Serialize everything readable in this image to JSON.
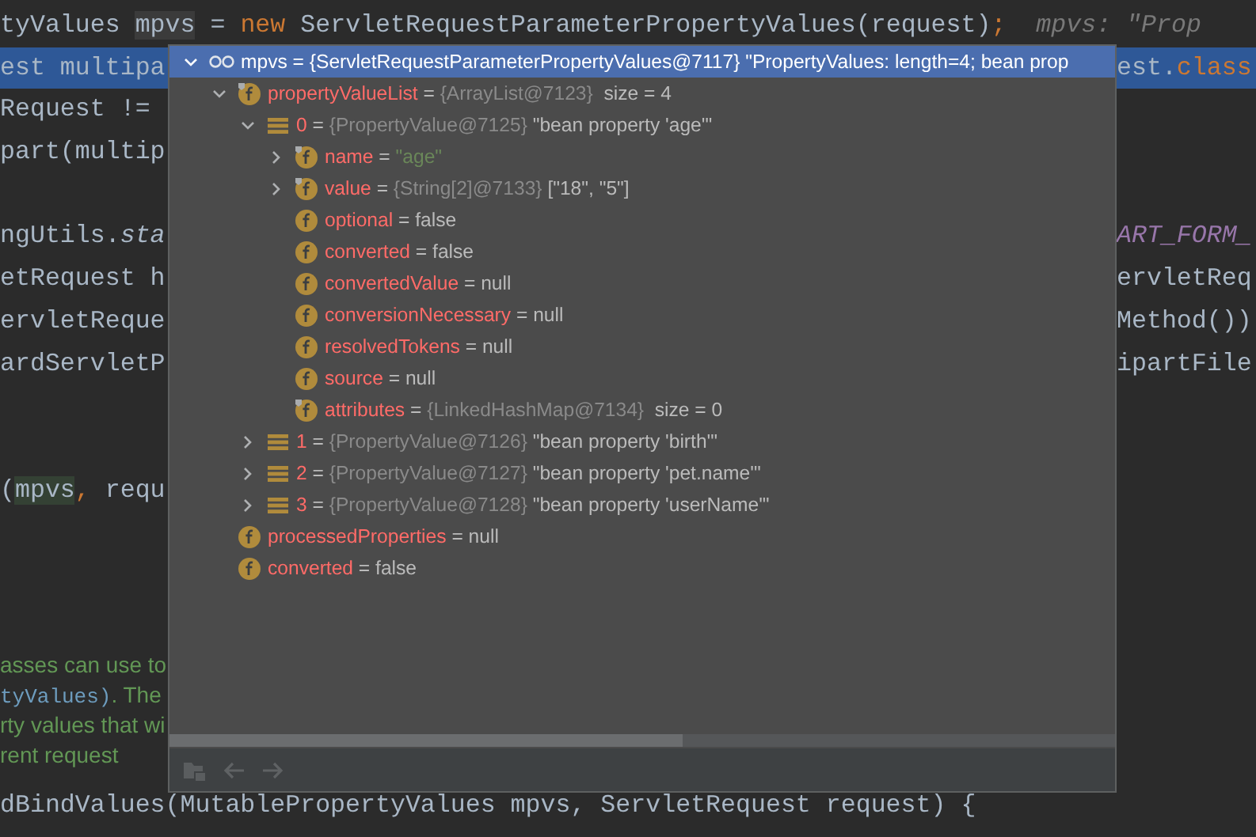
{
  "editor": {
    "lines": [
      {
        "kind": "code",
        "current": false,
        "left": [
          {
            "text": "tyValues ",
            "kind": "plain"
          },
          {
            "text": "mpvs",
            "kind": "usage"
          },
          {
            "text": " = ",
            "kind": "plain"
          },
          {
            "text": "new",
            "kind": "keyword"
          },
          {
            "text": " ServletRequestParameterPropertyValues(request)",
            "kind": "plain"
          },
          {
            "text": ";",
            "kind": "keyword"
          },
          {
            "text": "  mpvs: \"Prop",
            "kind": "hint"
          }
        ]
      },
      {
        "kind": "code",
        "current": true,
        "left": [
          {
            "text": "est multipa",
            "kind": "plain"
          }
        ],
        "right": [
          {
            "text": "est.",
            "kind": "plain"
          },
          {
            "text": "class",
            "kind": "keyword"
          }
        ]
      },
      {
        "kind": "code",
        "current": false,
        "left": [
          {
            "text": "Request !=",
            "kind": "plain"
          }
        ]
      },
      {
        "kind": "code",
        "current": false,
        "left": [
          {
            "text": "part(multip",
            "kind": "plain"
          }
        ]
      },
      {
        "kind": "blank",
        "current": false
      },
      {
        "kind": "code",
        "current": false,
        "left": [
          {
            "text": "ngUtils.",
            "kind": "plain"
          },
          {
            "text": "sta",
            "kind": "italic"
          }
        ],
        "right": [
          {
            "text": "ART_FORM_",
            "kind": "constant"
          }
        ]
      },
      {
        "kind": "code",
        "current": false,
        "left": [
          {
            "text": "etRequest h",
            "kind": "plain"
          }
        ],
        "right": [
          {
            "text": "ervletReq",
            "kind": "plain"
          }
        ]
      },
      {
        "kind": "code",
        "current": false,
        "left": [
          {
            "text": "ervletReque",
            "kind": "plain"
          }
        ],
        "right": [
          {
            "text": "Method())",
            "kind": "plain"
          }
        ]
      },
      {
        "kind": "code",
        "current": false,
        "left": [
          {
            "text": "ardServletP",
            "kind": "plain"
          }
        ],
        "right": [
          {
            "text": "ipartFile",
            "kind": "plain"
          }
        ]
      },
      {
        "kind": "blank",
        "current": false
      },
      {
        "kind": "blank",
        "current": false
      },
      {
        "kind": "code",
        "current": false,
        "left": [
          {
            "text": "(",
            "kind": "plain"
          },
          {
            "text": "mpvs",
            "kind": "write-usage"
          },
          {
            "text": ",",
            "kind": "keyword"
          },
          {
            "text": " requ",
            "kind": "plain"
          }
        ]
      },
      {
        "kind": "blank",
        "current": false
      },
      {
        "kind": "blank",
        "current": false
      },
      {
        "kind": "blank",
        "current": false
      },
      {
        "kind": "doc",
        "current": false,
        "left": [
          {
            "text": "asses can use to",
            "kind": "doc"
          }
        ]
      },
      {
        "kind": "doc",
        "current": false,
        "left": [
          {
            "text": "tyValues)",
            "kind": "doc-code"
          },
          {
            "text": ". The",
            "kind": "doc"
          }
        ]
      },
      {
        "kind": "doc",
        "current": false,
        "left": [
          {
            "text": "rty values that wi",
            "kind": "doc"
          }
        ]
      },
      {
        "kind": "doc",
        "current": false,
        "left": [
          {
            "text": "rent request",
            "kind": "doc"
          }
        ]
      },
      {
        "kind": "code",
        "current": false,
        "left": [
          {
            "text": "dBindValues(MutablePropertyValues mpvs, ServletRequest request) {",
            "kind": "plain"
          }
        ]
      }
    ]
  },
  "popup": {
    "root": {
      "name": "mpvs",
      "sep": "=",
      "ref": "{ServletRequestParameterPropertyValues@7117}",
      "value": "\"PropertyValues: length=4; bean prop",
      "expanded": true,
      "selected": true
    },
    "tree": [
      {
        "kind": "object-field",
        "name": "propertyValueList",
        "sep": "=",
        "ref": "{ArrayList@7123}",
        "value": " size = 4",
        "expandable": true,
        "expanded": true,
        "children": [
          {
            "kind": "element",
            "name": "0",
            "sep": "=",
            "ref": "{PropertyValue@7125}",
            "value": "\"bean property 'age'\"",
            "expandable": true,
            "expanded": true,
            "children": [
              {
                "kind": "string-field",
                "name": "name",
                "sep": "=",
                "value": "\"age\"",
                "expandable": true,
                "expanded": false
              },
              {
                "kind": "object-field",
                "name": "value",
                "sep": "=",
                "ref": "{String[2]@7133}",
                "value": "[\"18\", \"5\"]",
                "expandable": true,
                "expanded": false
              },
              {
                "kind": "field",
                "name": "optional",
                "sep": "=",
                "value": "false",
                "expandable": false
              },
              {
                "kind": "field",
                "name": "converted",
                "sep": "=",
                "value": "false",
                "expandable": false
              },
              {
                "kind": "field",
                "name": "convertedValue",
                "sep": "=",
                "value": "null",
                "expandable": false
              },
              {
                "kind": "field",
                "name": "conversionNecessary",
                "sep": "=",
                "value": "null",
                "expandable": false
              },
              {
                "kind": "field",
                "name": "resolvedTokens",
                "sep": "=",
                "value": "null",
                "expandable": false
              },
              {
                "kind": "field",
                "name": "source",
                "sep": "=",
                "value": "null",
                "expandable": false
              },
              {
                "kind": "object-field",
                "name": "attributes",
                "sep": "=",
                "ref": "{LinkedHashMap@7134}",
                "value": " size = 0",
                "expandable": false
              }
            ]
          },
          {
            "kind": "element",
            "name": "1",
            "sep": "=",
            "ref": "{PropertyValue@7126}",
            "value": "\"bean property 'birth'\"",
            "expandable": true,
            "expanded": false
          },
          {
            "kind": "element",
            "name": "2",
            "sep": "=",
            "ref": "{PropertyValue@7127}",
            "value": "\"bean property 'pet.name'\"",
            "expandable": true,
            "expanded": false
          },
          {
            "kind": "element",
            "name": "3",
            "sep": "=",
            "ref": "{PropertyValue@7128}",
            "value": "\"bean property 'userName'\"",
            "expandable": true,
            "expanded": false
          }
        ]
      },
      {
        "kind": "field",
        "name": "processedProperties",
        "sep": "=",
        "value": "null",
        "expandable": false
      },
      {
        "kind": "field",
        "name": "converted",
        "sep": "=",
        "value": "false",
        "expandable": false
      }
    ]
  }
}
